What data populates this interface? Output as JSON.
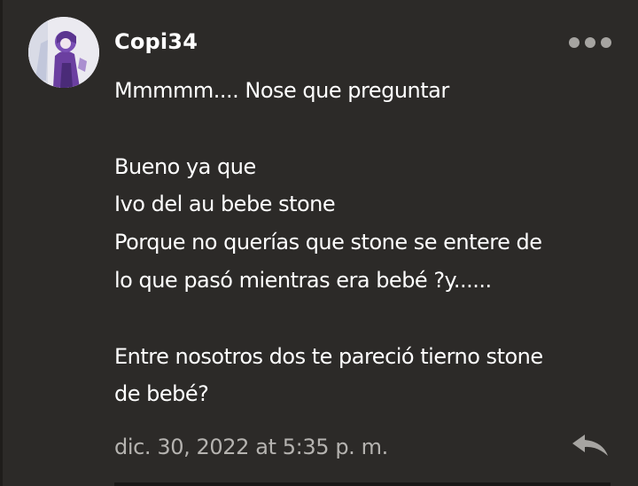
{
  "comment": {
    "username": "Copi34",
    "message_lines": [
      "Mmmmm.... Nose que preguntar",
      "",
      "Bueno ya que",
      "Ivo del au bebe stone",
      "Porque no querías que stone se entere de",
      "lo que pasó mientras era bebé ?y......",
      "",
      "Entre nosotros dos te pareció tierno stone",
      "de bebé?"
    ],
    "timestamp": "dic. 30, 2022 at 5:35 p. m.",
    "icons": {
      "more": "more-options-icon",
      "reply": "reply-icon"
    }
  },
  "colors": {
    "background": "#2c2a28",
    "text": "#ffffff",
    "muted": "#b5b3b0",
    "icon": "#a6a4a1"
  }
}
